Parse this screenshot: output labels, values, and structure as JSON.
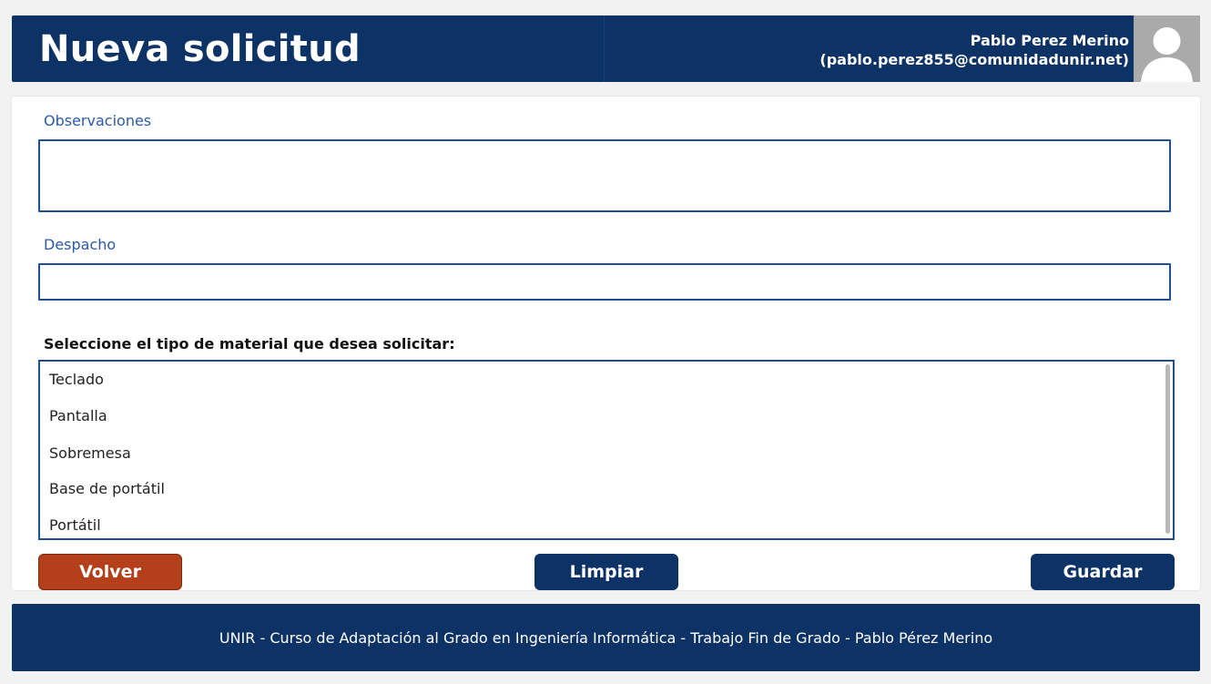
{
  "header": {
    "title": "Nueva solicitud",
    "user_name": "Pablo Perez Merino",
    "user_email": "(pablo.perez855@comunidadunir.net)"
  },
  "form": {
    "observaciones_label": "Observaciones",
    "observaciones_value": "",
    "despacho_label": "Despacho",
    "despacho_value": "",
    "material_prompt": "Seleccione el tipo de material que desea solicitar:",
    "material_options": [
      "Teclado",
      "Pantalla",
      "Sobremesa",
      "Base de portátil",
      "Portátil"
    ]
  },
  "buttons": {
    "volver": "Volver",
    "limpiar": "Limpiar",
    "guardar": "Guardar"
  },
  "footer": {
    "text": "UNIR - Curso de Adaptación al Grado en Ingeniería Informática - Trabajo Fin de Grado - Pablo Pérez Merino"
  },
  "colors": {
    "brand_navy": "#0d3265",
    "back_button": "#b3401a",
    "field_border": "#1f4e96",
    "label_blue": "#2b5aa7"
  },
  "icons": {
    "avatar": "user-avatar-placeholder-icon"
  }
}
